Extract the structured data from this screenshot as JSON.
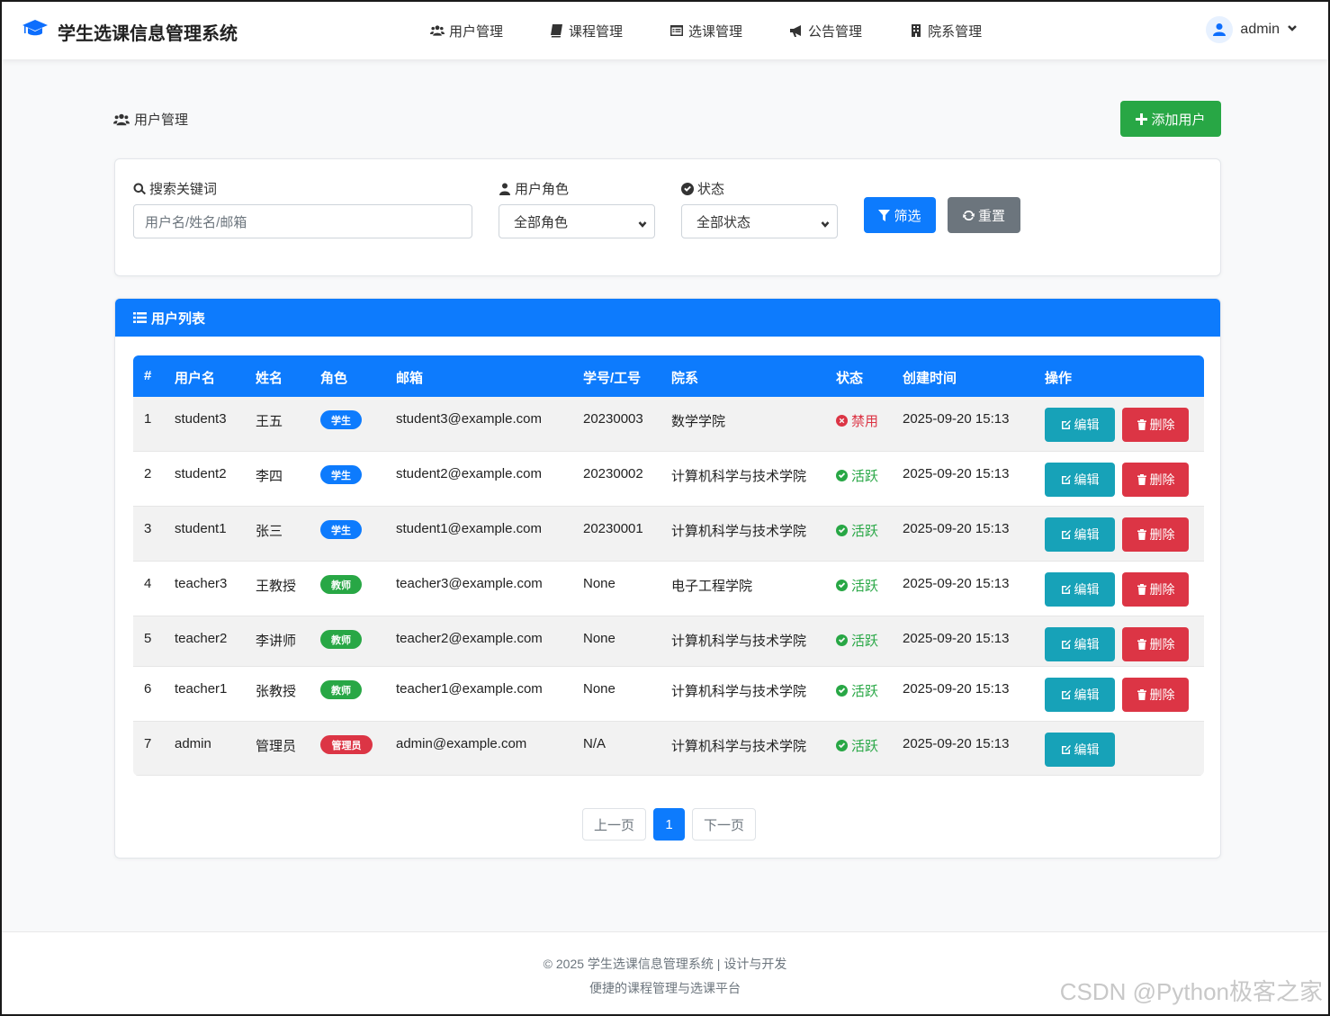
{
  "app": {
    "title": "学生选课信息管理系统",
    "user": "admin"
  },
  "nav": [
    {
      "label": "用户管理",
      "icon": "users-icon"
    },
    {
      "label": "课程管理",
      "icon": "book-icon"
    },
    {
      "label": "选课管理",
      "icon": "list-alt-icon"
    },
    {
      "label": "公告管理",
      "icon": "bullhorn-icon"
    },
    {
      "label": "院系管理",
      "icon": "building-icon"
    }
  ],
  "page": {
    "title": "用户管理",
    "add_button": "添加用户"
  },
  "filter": {
    "keyword_label": "搜索关键词",
    "keyword_placeholder": "用户名/姓名/邮箱",
    "role_label": "用户角色",
    "role_value": "全部角色",
    "status_label": "状态",
    "status_value": "全部状态",
    "filter_button": "筛选",
    "reset_button": "重置"
  },
  "list": {
    "title": "用户列表",
    "columns": [
      "#",
      "用户名",
      "姓名",
      "角色",
      "邮箱",
      "学号/工号",
      "院系",
      "状态",
      "创建时间",
      "操作"
    ],
    "rows": [
      {
        "no": "1",
        "username": "student3",
        "name": "王五",
        "role": "学生",
        "email": "student3@example.com",
        "id": "20230003",
        "dept": "数学学院",
        "status": "禁用",
        "created": "2025-09-20 15:13",
        "edit": "编辑",
        "delete": "删除"
      },
      {
        "no": "2",
        "username": "student2",
        "name": "李四",
        "role": "学生",
        "email": "student2@example.com",
        "id": "20230002",
        "dept": "计算机科学与技术学院",
        "status": "活跃",
        "created": "2025-09-20 15:13",
        "edit": "编辑",
        "delete": "删除"
      },
      {
        "no": "3",
        "username": "student1",
        "name": "张三",
        "role": "学生",
        "email": "student1@example.com",
        "id": "20230001",
        "dept": "计算机科学与技术学院",
        "status": "活跃",
        "created": "2025-09-20 15:13",
        "edit": "编辑",
        "delete": "删除"
      },
      {
        "no": "4",
        "username": "teacher3",
        "name": "王教授",
        "role": "教师",
        "email": "teacher3@example.com",
        "id": "None",
        "dept": "电子工程学院",
        "status": "活跃",
        "created": "2025-09-20 15:13",
        "edit": "编辑",
        "delete": "删除"
      },
      {
        "no": "5",
        "username": "teacher2",
        "name": "李讲师",
        "role": "教师",
        "email": "teacher2@example.com",
        "id": "None",
        "dept": "计算机科学与技术学院",
        "status": "活跃",
        "created": "2025-09-20 15:13",
        "edit": "编辑",
        "delete": "删除"
      },
      {
        "no": "6",
        "username": "teacher1",
        "name": "张教授",
        "role": "教师",
        "email": "teacher1@example.com",
        "id": "None",
        "dept": "计算机科学与技术学院",
        "status": "活跃",
        "created": "2025-09-20 15:13",
        "edit": "编辑",
        "delete": "删除"
      },
      {
        "no": "7",
        "username": "admin",
        "name": "管理员",
        "role": "管理员",
        "email": "admin@example.com",
        "id": "N/A",
        "dept": "计算机科学与技术学院",
        "status": "活跃",
        "created": "2025-09-20 15:13",
        "edit": "编辑"
      }
    ]
  },
  "pagination": {
    "prev": "上一页",
    "current": "1",
    "next": "下一页"
  },
  "footer": {
    "line1": "© 2025 学生选课信息管理系统 | 设计与开发",
    "line2": "便捷的课程管理与选课平台"
  },
  "watermark": "CSDN @Python极客之家",
  "colors": {
    "primary": "#0d7bfd",
    "success": "#28a745",
    "info": "#17a2b8",
    "danger": "#dc3545",
    "secondary": "#6c757d"
  }
}
